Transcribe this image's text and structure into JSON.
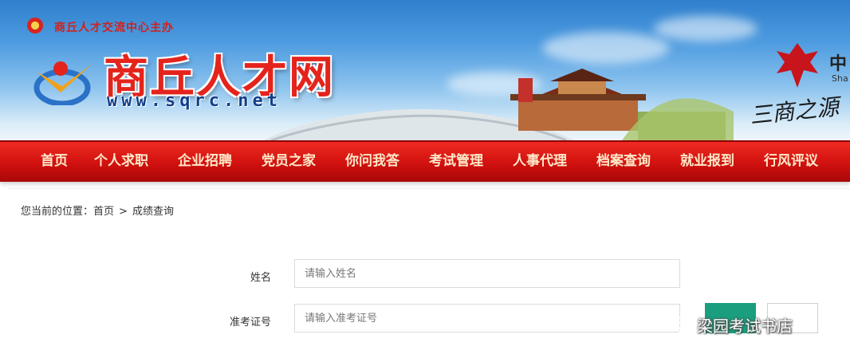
{
  "header": {
    "host_org": "商丘人才交流中心主办",
    "site_title": "商丘人才网",
    "site_url": "www.sqrc.net",
    "right_badge_cn": "中",
    "right_badge_en": "Sha",
    "calligraphy": "三商之源",
    "accent_red": "#e4241c",
    "url_blue": "#123f8a"
  },
  "nav": {
    "items": [
      "首页",
      "个人求职",
      "企业招聘",
      "党员之家",
      "你问我答",
      "考试管理",
      "人事代理",
      "档案查询",
      "就业报到",
      "行风评议"
    ],
    "bar_color": "#d0110f",
    "text_color": "#ffe9c9"
  },
  "breadcrumb": {
    "prefix": "您当前的位置：",
    "home": "首页",
    "separator": ">",
    "current": "成绩查询"
  },
  "form": {
    "name_label": "姓名",
    "name_placeholder": "请输入姓名",
    "exam_label": "准考证号",
    "exam_placeholder": "请输入准考证号",
    "submit_color": "#1b9e7d"
  },
  "watermark": {
    "text": "梁园考试书店",
    "icon": "wechat-icon"
  }
}
